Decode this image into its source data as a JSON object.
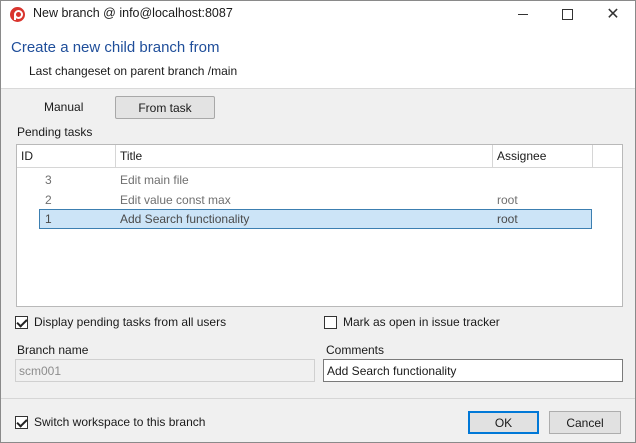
{
  "window": {
    "title": "New branch @ info@localhost:8087"
  },
  "header": {
    "title": "Create a new child branch from",
    "subtitle": "Last changeset on parent branch /main"
  },
  "mode": {
    "manual_label": "Manual",
    "from_task_label": "From task",
    "selected": "From task"
  },
  "pending": {
    "label": "Pending tasks",
    "columns": [
      "ID",
      "Title",
      "Assignee"
    ],
    "rows": [
      {
        "id": "3",
        "title": "Edit main file",
        "assignee": ""
      },
      {
        "id": "2",
        "title": "Edit value const max",
        "assignee": "root"
      },
      {
        "id": "1",
        "title": "Add Search functionality",
        "assignee": "root"
      }
    ],
    "selected_index": 2
  },
  "options": {
    "display_all_label": "Display pending tasks from all users",
    "display_all_checked": true,
    "mark_open_label": "Mark as open in issue tracker",
    "mark_open_checked": false,
    "switch_label": "Switch workspace to this branch",
    "switch_checked": true
  },
  "fields": {
    "branch_name_label": "Branch name",
    "branch_name_value": "scm001",
    "comments_label": "Comments",
    "comments_value": "Add Search functionality"
  },
  "buttons": {
    "ok_label": "OK",
    "cancel_label": "Cancel"
  },
  "colors": {
    "accent": "#0078d7",
    "header_title": "#1f4e9a",
    "selection_bg": "#cce4f7",
    "selection_border": "#3c7fb1",
    "app_icon": "#d9352e"
  },
  "icons": {
    "app": "plastic-scm-logo-icon",
    "minimize": "minimize-icon",
    "maximize": "maximize-icon",
    "close": "close-icon",
    "check": "checkmark-icon"
  }
}
